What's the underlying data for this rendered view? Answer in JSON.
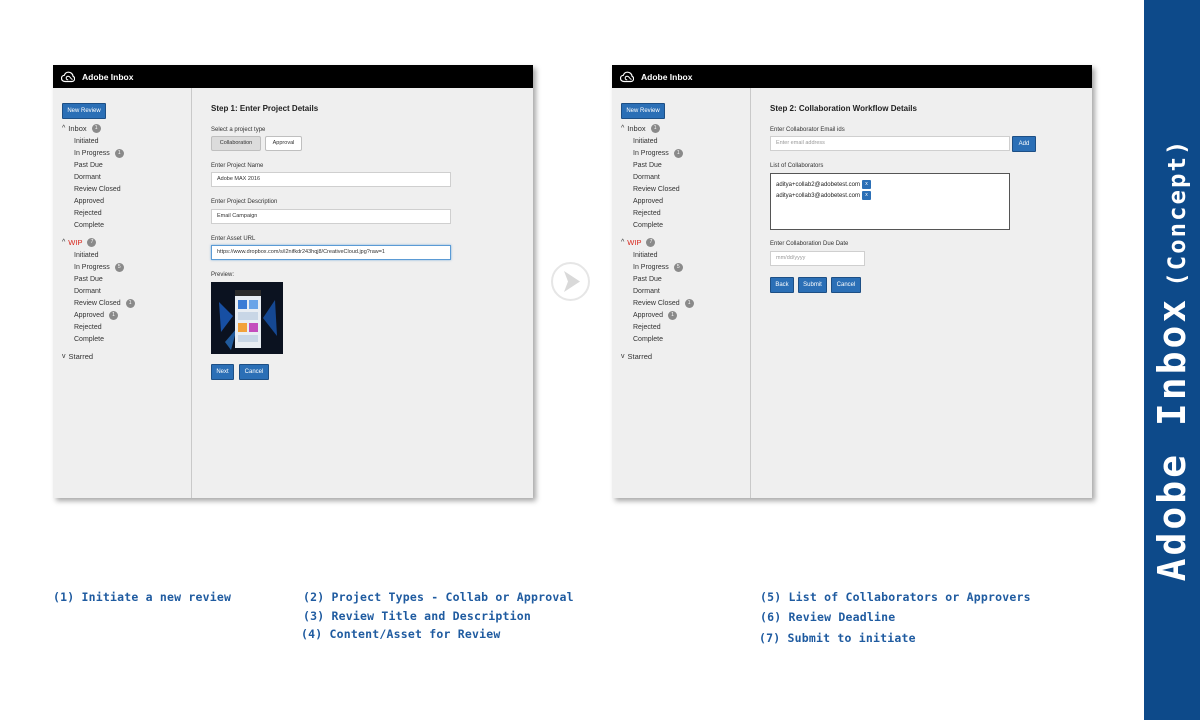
{
  "banner": {
    "title": "Adobe Inbox",
    "subtitle": "(Concept)"
  },
  "app": {
    "title": "Adobe Inbox",
    "new_review_label": "New Review"
  },
  "sidebar": {
    "inbox": {
      "label": "Inbox",
      "count": "1",
      "items": [
        {
          "label": "Initiated",
          "count": ""
        },
        {
          "label": "In Progress",
          "count": "1"
        },
        {
          "label": "Past Due",
          "count": ""
        },
        {
          "label": "Dormant",
          "count": ""
        },
        {
          "label": "Review Closed",
          "count": ""
        },
        {
          "label": "Approved",
          "count": ""
        },
        {
          "label": "Rejected",
          "count": ""
        },
        {
          "label": "Complete",
          "count": ""
        }
      ]
    },
    "wip": {
      "label": "WIP",
      "count": "7",
      "items": [
        {
          "label": "Initiated",
          "count": ""
        },
        {
          "label": "In Progress",
          "count": "5"
        },
        {
          "label": "Past Due",
          "count": ""
        },
        {
          "label": "Dormant",
          "count": ""
        },
        {
          "label": "Review Closed",
          "count": "1"
        },
        {
          "label": "Approved",
          "count": "1"
        },
        {
          "label": "Rejected",
          "count": ""
        },
        {
          "label": "Complete",
          "count": ""
        }
      ]
    },
    "starred": {
      "label": "Starred"
    }
  },
  "step1": {
    "title": "Step 1: Enter Project Details",
    "type_label": "Select a project type",
    "type_options": [
      "Collaboration",
      "Approval"
    ],
    "name_label": "Enter Project Name",
    "name_value": "Adobe MAX 2016",
    "desc_label": "Enter Project Description",
    "desc_value": "Email Campaign",
    "url_label": "Enter Asset URL",
    "url_value": "https://www.dropbox.com/s/i2nifkdr243hqj8/CreativeCloud.jpg?raw=1",
    "preview_label": "Preview:",
    "next_label": "Next",
    "cancel_label": "Cancel"
  },
  "step2": {
    "title": "Step 2: Collaboration Workflow Details",
    "email_label": "Enter Collaborator Email ids",
    "email_placeholder": "Enter email address",
    "add_label": "Add",
    "list_label": "List of Collaborators",
    "collaborators": [
      "aditya+collab2@adobetest.com",
      "aditya+collab3@adobetest.com"
    ],
    "remove_label": "x",
    "due_label": "Enter Collaboration Due Date",
    "due_placeholder": "mm/dd/yyyy",
    "back_label": "Back",
    "submit_label": "Submit",
    "cancel_label": "Cancel"
  },
  "captions": {
    "c1": "(1) Initiate a new review",
    "c2": "(2) Project Types - Collab or Approval",
    "c3": "(3) Review Title and Description",
    "c4": "(4) Content/Asset for Review",
    "c5": "(5) List of Collaborators or Approvers",
    "c6": "(6) Review Deadline",
    "c7": "(7) Submit to initiate"
  },
  "colors": {
    "accent": "#2b6fb6",
    "banner": "#0d4a8a",
    "caption": "#1f5ba0",
    "wip": "#d9261c"
  }
}
